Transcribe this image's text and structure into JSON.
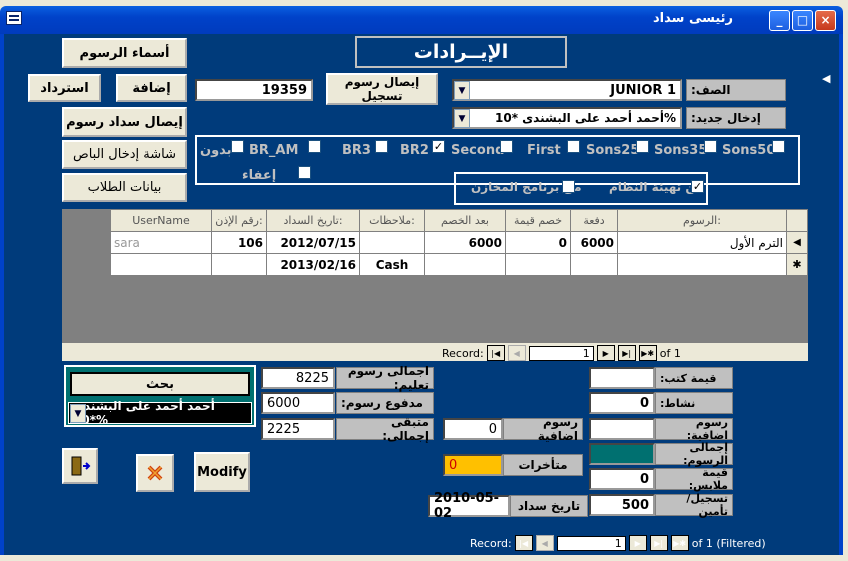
{
  "window": {
    "title": "رئيسى سداد",
    "controls": [
      "_",
      "□",
      "×"
    ]
  },
  "header": {
    "title": "الإيــرادات"
  },
  "buttons": {
    "fees_names": "أسماء الرسوم",
    "add": "إضافة",
    "refund": "استرداد",
    "fee_payment_receipt": "إيصال سداد رسوم",
    "bus_entry_screen": "شاشة إدخال الباص",
    "student_data": "بيانات الطلاب",
    "registration_receipt": "إيصال رسوم تسجيل",
    "search": "بحث",
    "modify": "Modify"
  },
  "top": {
    "number": "19359",
    "class_label": "الصف:",
    "class_value": "JUNIOR 1",
    "new_entry_label": "إدخال جديد:",
    "new_entry_value": "أحمد أحمد على البشندى *10%"
  },
  "checkboxes": {
    "bdoun": "بدون",
    "br_am": "BR_AM",
    "br3": "BR3",
    "br2": "BR2",
    "second": "Second",
    "first": "First",
    "sons25": "Sons25",
    "sons35": "Sons35",
    "sons50": "Sons50",
    "exemption": "إعفاء",
    "from_inventory": "من برنامج المخازن",
    "from_system_setup": "من تهيئة النظام"
  },
  "grid": {
    "headers": [
      "الرسوم:",
      "دفعة",
      "خصم قيمة",
      "بعد الخصم",
      "ملاحظات:",
      "تاريخ السداد:",
      "رقم الإذن:",
      "UserName"
    ],
    "rows": [
      [
        "الترم الأول",
        "6000",
        "0",
        "6000",
        "",
        "2012/07/15",
        "106",
        "sara"
      ],
      [
        "",
        "",
        "",
        "",
        "Cash",
        "2013/02/16",
        "",
        ""
      ]
    ],
    "record_label": "Record:",
    "record_pos": "1",
    "record_of": "of  1"
  },
  "summary_left": {
    "total_tuition_label": "اجمالى رسوم تعليم:",
    "total_tuition": "8225",
    "paid_label": "مدفوع رسوم:",
    "paid": "6000",
    "remaining_label": "متبقى إجمالى:",
    "remaining": "2225",
    "search_combo": "أحمد أحمد على البشندى *10%"
  },
  "summary_mid": {
    "additional_label": "رسوم اضافية",
    "additional": "0",
    "arrears_label": "متأخرات",
    "arrears": "0",
    "pay_date_label": "تاريخ سداد",
    "pay_date": "2010-05-02"
  },
  "summary_right": {
    "books_label": "قيمة كتب:",
    "books": "",
    "activity_label": "نشاط:",
    "activity": "0",
    "extra_fees_label": "رسوم اضافية:",
    "extra_fees": "",
    "total_fees_label": "إجمالى الرسوم:",
    "total_fees": "",
    "uniform_label": "قيمة ملابس:",
    "uniform": "0",
    "registration_label": "تسجيل/تأمين",
    "registration": "500"
  },
  "footer": {
    "record_label": "Record:",
    "record_pos": "1",
    "record_of": "of  1 (Filtered)"
  }
}
